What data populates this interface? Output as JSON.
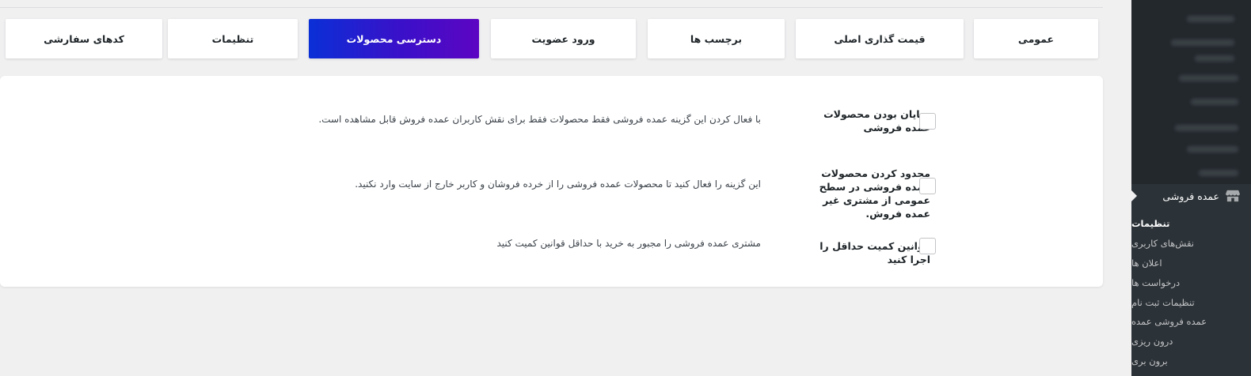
{
  "tabs": [
    {
      "label": "عمومی",
      "active": false
    },
    {
      "label": "قیمت گذاری اصلی",
      "active": false
    },
    {
      "label": "برچسب ها",
      "active": false
    },
    {
      "label": "ورود عضویت",
      "active": false
    },
    {
      "label": "دسترسی محصولات",
      "active": true
    },
    {
      "label": "تنظیمات",
      "active": false
    },
    {
      "label": "کدهای سفارشی",
      "active": false
    }
  ],
  "settings": [
    {
      "label": "نمایان بودن محصولات عمده فروشی",
      "description": "با فعال کردن این گزینه عمده فروشی فقط محصولات فقط برای نقش کاربران عمده فروش قابل مشاهده است.",
      "checked": false
    },
    {
      "label": "محدود کردن محصولات عمده فروشی در سطح عمومی از مشتری غیر عمده فروش.",
      "description": "این گزینه را فعال کنید تا محصولات عمده فروشی را از خرده فروشان و کاربر خارج از سایت وارد نکنید.",
      "checked": false
    },
    {
      "label": "قوانین کمیت حداقل را اجرا کنید",
      "description": "مشتری عمده فروشی را مجبور به خرید با حداقل قوانین کمیت کنید",
      "checked": false
    }
  ],
  "sidebar": {
    "current_menu": {
      "label": "عمده فروشی",
      "icon": "store-icon"
    },
    "submenu": [
      {
        "label": "تنظیمات",
        "current": true
      },
      {
        "label": "نقش‌های کاربری",
        "current": false
      },
      {
        "label": "اعلان ها",
        "current": false
      },
      {
        "label": "درخواست ها",
        "current": false
      },
      {
        "label": "تنظیمات ثبت نام",
        "current": false
      },
      {
        "label": "عمده فروشی عمده",
        "current": false
      },
      {
        "label": "درون ریزی",
        "current": false
      },
      {
        "label": "برون بری",
        "current": false
      }
    ]
  },
  "colors": {
    "accent_start": "#0a2fd6",
    "accent_end": "#5c05c2",
    "sidebar_bg": "#2c3338"
  }
}
